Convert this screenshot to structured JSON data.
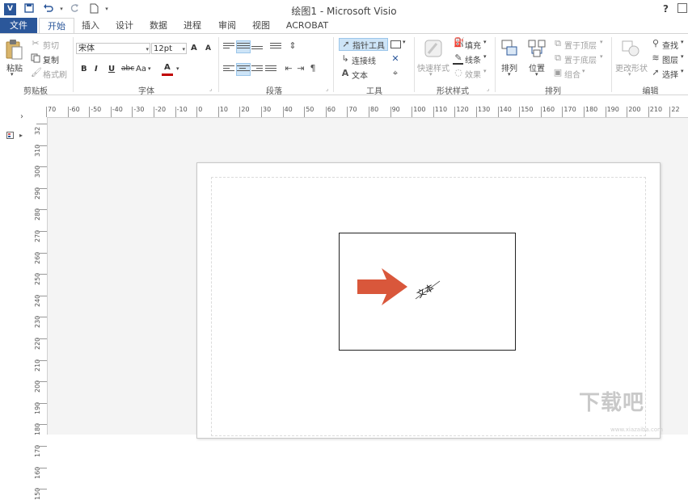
{
  "window": {
    "app_icon_text": "V",
    "title": "绘图1 - Microsoft Visio",
    "help_label": "?",
    "qat_icons": [
      "save-icon",
      "undo-icon",
      "redo-icon",
      "new-document-icon"
    ]
  },
  "tabs": [
    "文件",
    "开始",
    "插入",
    "设计",
    "数据",
    "进程",
    "审阅",
    "视图",
    "ACROBAT"
  ],
  "ribbon": {
    "clipboard": {
      "label": "剪贴板",
      "paste": "粘贴",
      "cut": "剪切",
      "copy": "复制",
      "format_painter": "格式刷"
    },
    "font": {
      "label": "字体",
      "font_name": "宋体",
      "font_size": "12pt",
      "grow": "A",
      "shrink": "A",
      "bold": "B",
      "italic": "I",
      "underline": "U",
      "strike": "abc",
      "case": "Aa",
      "color": "A",
      "color_value": "#c00000"
    },
    "paragraph": {
      "label": "段落"
    },
    "tools": {
      "label": "工具",
      "pointer": "指针工具",
      "connector": "连接线",
      "text": "文本"
    },
    "shape_styles": {
      "label": "形状样式",
      "quick_styles": "快速样式",
      "fill": "填充",
      "line": "线条",
      "effects": "效果"
    },
    "arrange": {
      "label": "排列",
      "arrange": "排列",
      "position": "位置",
      "bring_front": "置于顶层",
      "send_back": "置于底层",
      "group": "组合"
    },
    "editing": {
      "label": "编辑",
      "change_shape": "更改形状",
      "find": "查找",
      "layers": "图层",
      "select": "选择"
    }
  },
  "ruler": {
    "h_labels": [
      "70",
      "-60",
      "-50",
      "-40",
      "-30",
      "-20",
      "-10",
      "0",
      "10",
      "20",
      "30",
      "40",
      "50",
      "60",
      "70",
      "80",
      "90",
      "100",
      "110",
      "120",
      "130",
      "140",
      "150",
      "160",
      "170",
      "180",
      "190",
      "200",
      "210",
      "22"
    ],
    "v_labels": [
      "32",
      "310",
      "300",
      "290",
      "280",
      "270",
      "260",
      "250",
      "240",
      "230",
      "220",
      "210",
      "200",
      "190",
      "180",
      "170",
      "160",
      "150"
    ]
  },
  "drawing": {
    "shape_text": "文本",
    "arrow_color": "#d9573b"
  },
  "watermark": {
    "text": "下载吧",
    "url": "www.xiazaiba.com"
  }
}
